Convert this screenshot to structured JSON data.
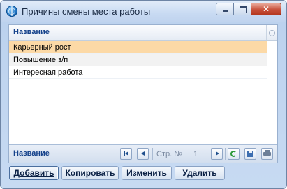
{
  "window": {
    "title": "Причины смены места работы",
    "close_glyph": "✕"
  },
  "grid": {
    "column_header": "Название",
    "rows": [
      {
        "label": "Карьерный рост",
        "selected": true
      },
      {
        "label": "Повышение з/п",
        "selected": false
      },
      {
        "label": "Интересная работа",
        "selected": false
      }
    ]
  },
  "footer": {
    "field_label": "Название",
    "page_label": "Стр. №",
    "page_number": "1",
    "icons": [
      "first-page-icon",
      "prev-page-icon",
      "next-page-icon",
      "refresh-icon",
      "save-icon",
      "print-icon"
    ]
  },
  "actions": {
    "add": "Добавить",
    "copy": "Копировать",
    "edit": "Изменить",
    "delete": "Удалить"
  },
  "colors": {
    "selected_row": "#fcd9a6",
    "header_text": "#15428b",
    "close_button": "#c8513c"
  }
}
